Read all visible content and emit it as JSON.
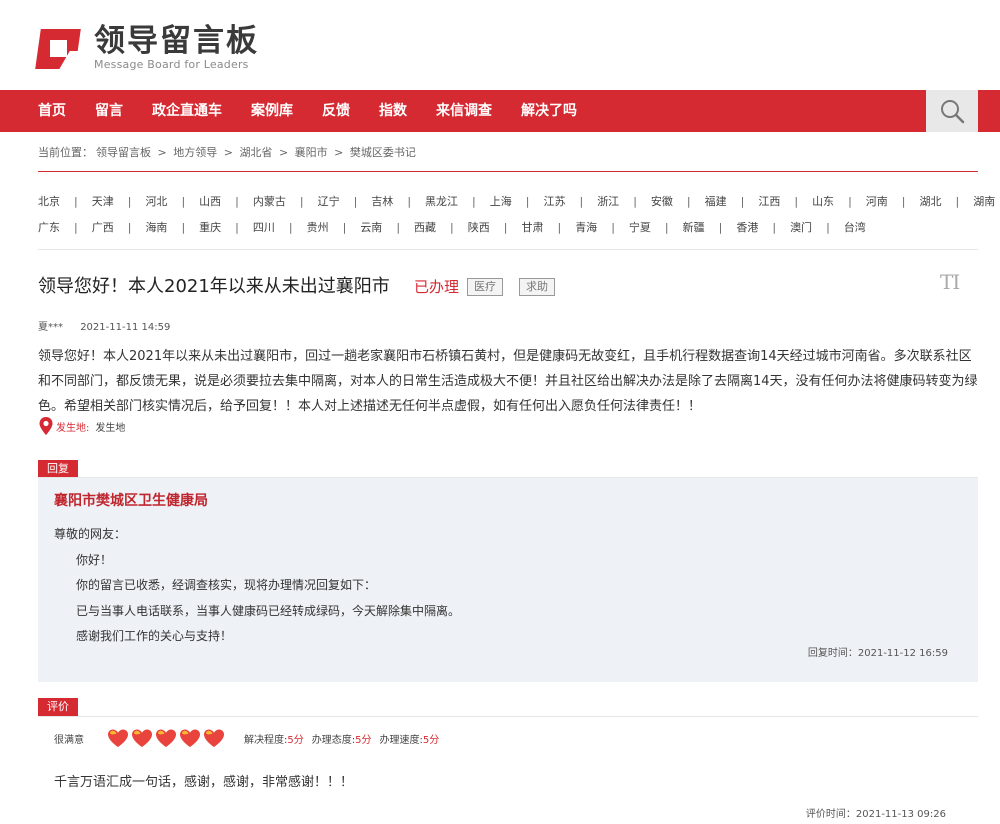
{
  "header": {
    "logo_title": "领导留言板",
    "logo_subtitle": "Message Board for Leaders"
  },
  "nav": {
    "items": [
      "首页",
      "留言",
      "政企直通车",
      "案例库",
      "反馈",
      "指数",
      "来信调查",
      "解决了吗"
    ],
    "search_icon": "search-icon"
  },
  "breadcrumb": {
    "prefix": "当前位置：",
    "items": [
      "领导留言板",
      "地方领导",
      "湖北省",
      "襄阳市",
      "樊城区委书记"
    ],
    "separator": ">"
  },
  "regions": {
    "row1": [
      "北京",
      "天津",
      "河北",
      "山西",
      "内蒙古",
      "辽宁",
      "吉林",
      "黑龙江",
      "上海",
      "江苏",
      "浙江",
      "安徽",
      "福建",
      "江西",
      "山东",
      "河南",
      "湖北",
      "湖南"
    ],
    "row2": [
      "广东",
      "广西",
      "海南",
      "重庆",
      "四川",
      "贵州",
      "云南",
      "西藏",
      "陕西",
      "甘肃",
      "青海",
      "宁夏",
      "新疆",
      "香港",
      "澳门",
      "台湾"
    ]
  },
  "message": {
    "title": "领导您好！本人2021年以来从未出过襄阳市",
    "status": "已办理",
    "tags": [
      "医疗",
      "求助"
    ],
    "font_toggle": "TI",
    "author": "夏***",
    "time": "2021-11-11 14:59",
    "content": "领导您好！本人2021年以来从未出过襄阳市，回过一趟老家襄阳市石桥镇石黄村，但是健康码无故变红，且手机行程数据查询14天经过城市河南省。多次联系社区和不同部门，都反馈无果，说是必须要拉去集中隔离，对本人的日常生活造成极大不便！并且社区给出解决办法是除了去隔离14天，没有任何办法将健康码转变为绿色。希望相关部门核实情况后，给予回复！！本人对上述描述无任何半点虚假，如有任何出入愿负任何法律责任！！",
    "location_label": "发生地:",
    "location_value": "发生地"
  },
  "reply": {
    "tag": "回复",
    "org": "襄阳市樊城区卫生健康局",
    "greeting": "尊敬的网友：",
    "lines": [
      "你好！",
      "你的留言已收悉，经调查核实，现将办理情况回复如下：",
      "已与当事人电话联系，当事人健康码已经转成绿码，今天解除集中隔离。",
      "感谢我们工作的关心与支持！"
    ],
    "time": "回复时间：2021-11-12 16:59"
  },
  "evaluation": {
    "tag": "评价",
    "overall": "很满意",
    "hearts": 5,
    "heart_colors": {
      "fill": "#e8433d",
      "accent": "#f5b82e"
    },
    "metrics": [
      {
        "label": "解决程度:",
        "value": "5分"
      },
      {
        "label": "办理态度:",
        "value": "5分"
      },
      {
        "label": "办理速度:",
        "value": "5分"
      }
    ],
    "comment": "千言万语汇成一句话，感谢，感谢，非常感谢！！！",
    "time": "评价时间：2021-11-13 09:26"
  },
  "colors": {
    "brand_red": "#d62a33",
    "reply_bg": "#eef1f6"
  }
}
